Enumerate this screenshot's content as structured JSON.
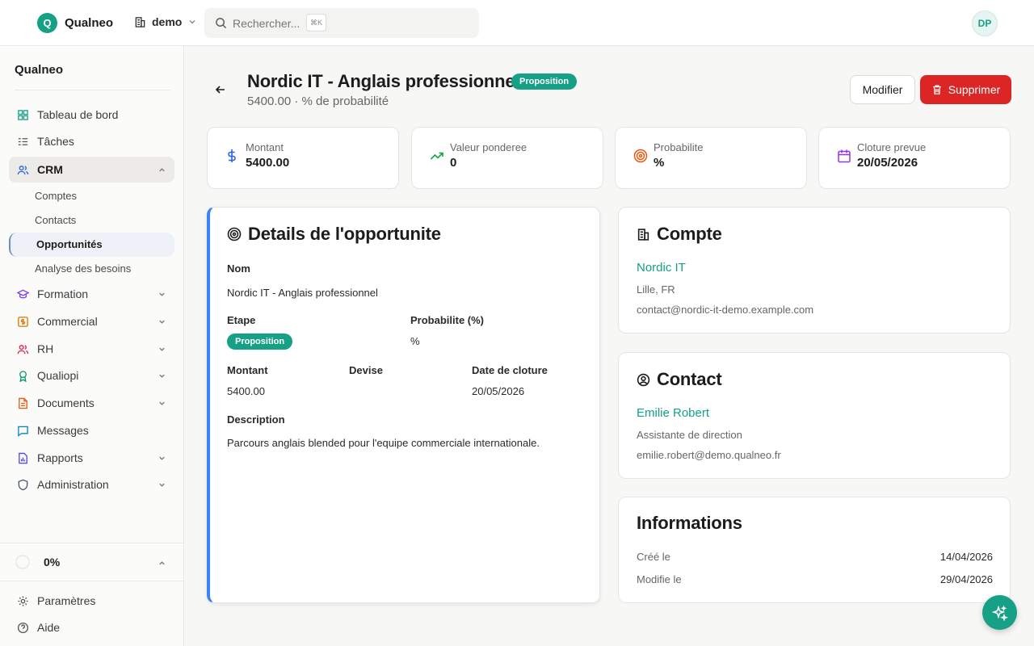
{
  "app": {
    "name": "Qualneo",
    "logo_letter": "Q"
  },
  "topbar": {
    "workspace": "demo",
    "search_placeholder": "Rechercher...",
    "search_shortcut": "⌘K",
    "avatar_initials": "DP"
  },
  "sidebar": {
    "brand": "Qualneo",
    "items": [
      {
        "label": "Tableau de bord",
        "icon": "dashboard-icon"
      },
      {
        "label": "Tâches",
        "icon": "tasks-icon"
      },
      {
        "label": "CRM",
        "icon": "users-icon",
        "expanded": true,
        "active": true
      },
      {
        "label": "Formation",
        "icon": "graduation-icon"
      },
      {
        "label": "Commercial",
        "icon": "dollar-icon"
      },
      {
        "label": "RH",
        "icon": "people-icon"
      },
      {
        "label": "Qualiopi",
        "icon": "award-icon"
      },
      {
        "label": "Documents",
        "icon": "document-icon"
      },
      {
        "label": "Messages",
        "icon": "message-icon"
      },
      {
        "label": "Rapports",
        "icon": "report-icon"
      },
      {
        "label": "Administration",
        "icon": "shield-icon"
      }
    ],
    "crm_sub": [
      "Comptes",
      "Contacts",
      "Opportunités",
      "Analyse des besoins"
    ],
    "progress": "0%",
    "footer": [
      {
        "label": "Paramètres",
        "icon": "gear-icon"
      },
      {
        "label": "Aide",
        "icon": "help-icon"
      }
    ]
  },
  "page": {
    "title": "Nordic IT - Anglais professionnel",
    "stage_badge": "Proposition",
    "subtitle": "5400.00 · % de probabilité",
    "edit_label": "Modifier",
    "delete_label": "Supprimer"
  },
  "stats": [
    {
      "label": "Montant",
      "value": "5400.00",
      "icon": "dollar-icon",
      "color": "#2563eb"
    },
    {
      "label": "Valeur ponderee",
      "value": "0",
      "icon": "trending-up-icon",
      "color": "#16a34a"
    },
    {
      "label": "Probabilite",
      "value": "%",
      "icon": "target-icon",
      "color": "#ea580c"
    },
    {
      "label": "Cloture prevue",
      "value": "20/05/2026",
      "icon": "calendar-icon",
      "color": "#9333ea"
    }
  ],
  "details": {
    "title": "Details de l'opportunite",
    "nom_label": "Nom",
    "nom_value": "Nordic IT - Anglais professionnel",
    "etape_label": "Etape",
    "etape_value": "Proposition",
    "prob_label": "Probabilite (%)",
    "prob_value": "%",
    "montant_label": "Montant",
    "montant_value": "5400.00",
    "devise_label": "Devise",
    "devise_value": "",
    "date_label": "Date de cloture",
    "date_value": "20/05/2026",
    "desc_label": "Description",
    "desc_value": "Parcours anglais blended pour l'equipe commerciale internationale."
  },
  "compte": {
    "title": "Compte",
    "name": "Nordic IT",
    "location": "Lille, FR",
    "email": "contact@nordic-it-demo.example.com"
  },
  "contact": {
    "title": "Contact",
    "name": "Emilie Robert",
    "role": "Assistante de direction",
    "email": "emilie.robert@demo.qualneo.fr"
  },
  "informations": {
    "title": "Informations",
    "rows": [
      {
        "label": "Créé le",
        "value": "14/04/2026"
      },
      {
        "label": "Modifie le",
        "value": "29/04/2026"
      }
    ]
  },
  "colors": {
    "accent": "#16a085",
    "danger": "#dc2626",
    "highlight": "#3b82f6"
  }
}
